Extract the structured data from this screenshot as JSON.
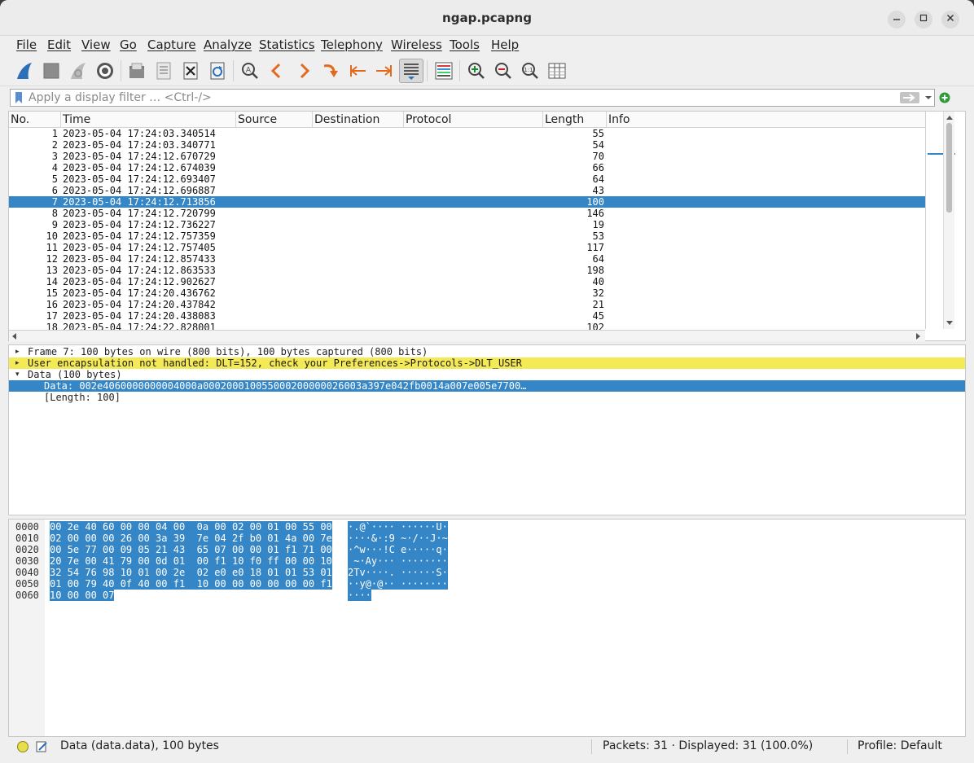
{
  "window": {
    "title": "ngap.pcapng"
  },
  "menu": [
    "File",
    "Edit",
    "View",
    "Go",
    "Capture",
    "Analyze",
    "Statistics",
    "Telephony",
    "Wireless",
    "Tools",
    "Help"
  ],
  "filter": {
    "placeholder": "Apply a display filter … <Ctrl-/>"
  },
  "packet_list": {
    "columns": [
      "No.",
      "Time",
      "Source",
      "Destination",
      "Protocol",
      "Length",
      "Info"
    ],
    "rows": [
      {
        "no": "1",
        "time": "2023-05-04 17:24:03.340514",
        "length": "55"
      },
      {
        "no": "2",
        "time": "2023-05-04 17:24:03.340771",
        "length": "54"
      },
      {
        "no": "3",
        "time": "2023-05-04 17:24:12.670729",
        "length": "70"
      },
      {
        "no": "4",
        "time": "2023-05-04 17:24:12.674039",
        "length": "66"
      },
      {
        "no": "5",
        "time": "2023-05-04 17:24:12.693407",
        "length": "64"
      },
      {
        "no": "6",
        "time": "2023-05-04 17:24:12.696887",
        "length": "43"
      },
      {
        "no": "7",
        "time": "2023-05-04 17:24:12.713856",
        "length": "100"
      },
      {
        "no": "8",
        "time": "2023-05-04 17:24:12.720799",
        "length": "146"
      },
      {
        "no": "9",
        "time": "2023-05-04 17:24:12.736227",
        "length": "19"
      },
      {
        "no": "10",
        "time": "2023-05-04 17:24:12.757359",
        "length": "53"
      },
      {
        "no": "11",
        "time": "2023-05-04 17:24:12.757405",
        "length": "117"
      },
      {
        "no": "12",
        "time": "2023-05-04 17:24:12.857433",
        "length": "64"
      },
      {
        "no": "13",
        "time": "2023-05-04 17:24:12.863533",
        "length": "198"
      },
      {
        "no": "14",
        "time": "2023-05-04 17:24:12.902627",
        "length": "40"
      },
      {
        "no": "15",
        "time": "2023-05-04 17:24:20.436762",
        "length": "32"
      },
      {
        "no": "16",
        "time": "2023-05-04 17:24:20.437842",
        "length": "21"
      },
      {
        "no": "17",
        "time": "2023-05-04 17:24:20.438083",
        "length": "45"
      },
      {
        "no": "18",
        "time": "2023-05-04 17:24:22.828001",
        "length": "102"
      }
    ]
  },
  "details": {
    "frame": "Frame 7: 100 bytes on wire (800 bits), 100 bytes captured (800 bits)",
    "warning": "User encapsulation not handled: DLT=152, check your Preferences->Protocols->DLT_USER",
    "data": "Data (100 bytes)",
    "data_value": "Data: 002e4060000000004000a000200010055000200000026003a397e042fb0014a007e005e7700…",
    "length": "[Length: 100]"
  },
  "bytes": [
    {
      "offset": "0000",
      "hex": "00 2e 40 60 00 00 04 00  0a 00 02 00 01 00 55 00",
      "ascii": "·.@`···· ······U·"
    },
    {
      "offset": "0010",
      "hex": "02 00 00 00 26 00 3a 39  7e 04 2f b0 01 4a 00 7e",
      "ascii": "····&·:9 ~·/··J·~"
    },
    {
      "offset": "0020",
      "hex": "00 5e 77 00 09 05 21 43  65 07 00 00 01 f1 71 00",
      "ascii": "·^w···!C e·····q·"
    },
    {
      "offset": "0030",
      "hex": "20 7e 00 41 79 00 0d 01  00 f1 10 f0 ff 00 00 10",
      "ascii": " ~·Ay··· ········"
    },
    {
      "offset": "0040",
      "hex": "32 54 76 98 10 01 00 2e  02 e0 e0 18 01 01 53 01",
      "ascii": "2Tv····. ······S·"
    },
    {
      "offset": "0050",
      "hex": "01 00 79 40 0f 40 00 f1  10 00 00 00 00 00 00 f1",
      "ascii": "··y@·@·· ········"
    },
    {
      "offset": "0060",
      "hex": "10 00 00 07",
      "ascii": "····"
    }
  ],
  "status": {
    "field": "Data (data.data), 100 bytes",
    "packets": "Packets: 31 · Displayed: 31 (100.0%)",
    "profile": "Profile: Default"
  }
}
